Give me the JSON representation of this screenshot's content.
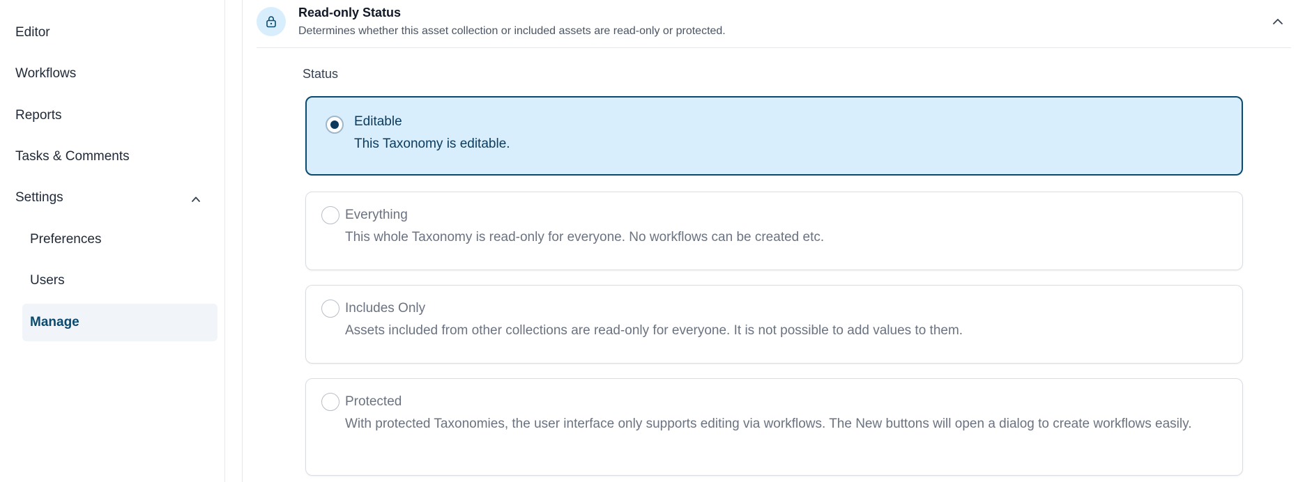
{
  "sidebar": {
    "items": [
      {
        "label": "Editor"
      },
      {
        "label": "Workflows"
      },
      {
        "label": "Reports"
      },
      {
        "label": "Tasks & Comments"
      },
      {
        "label": "Settings"
      }
    ],
    "settings_children": [
      {
        "label": "Preferences"
      },
      {
        "label": "Users"
      },
      {
        "label": "Manage"
      }
    ]
  },
  "panel": {
    "icon": "lock-icon",
    "title": "Read-only Status",
    "subtitle": "Determines whether this asset collection or included assets are read-only or protected.",
    "status_label": "Status",
    "options": [
      {
        "title": "Editable",
        "description": "This Taxonomy is editable.",
        "selected": true
      },
      {
        "title": "Everything",
        "description": "This whole Taxonomy is read-only for everyone. No workflows can be created etc.",
        "selected": false
      },
      {
        "title": "Includes Only",
        "description": "Assets included from other collections are read-only for everyone. It is not possible to add values to them.",
        "selected": false
      },
      {
        "title": "Protected",
        "description": "With protected Taxonomies, the user interface only supports editing via workflows. The New buttons will open a dialog to create workflows easily.",
        "selected": false
      }
    ]
  },
  "colors": {
    "accent": "#0b4a6f",
    "selected_bg": "#d9eefc",
    "border": "#e5e7eb"
  }
}
